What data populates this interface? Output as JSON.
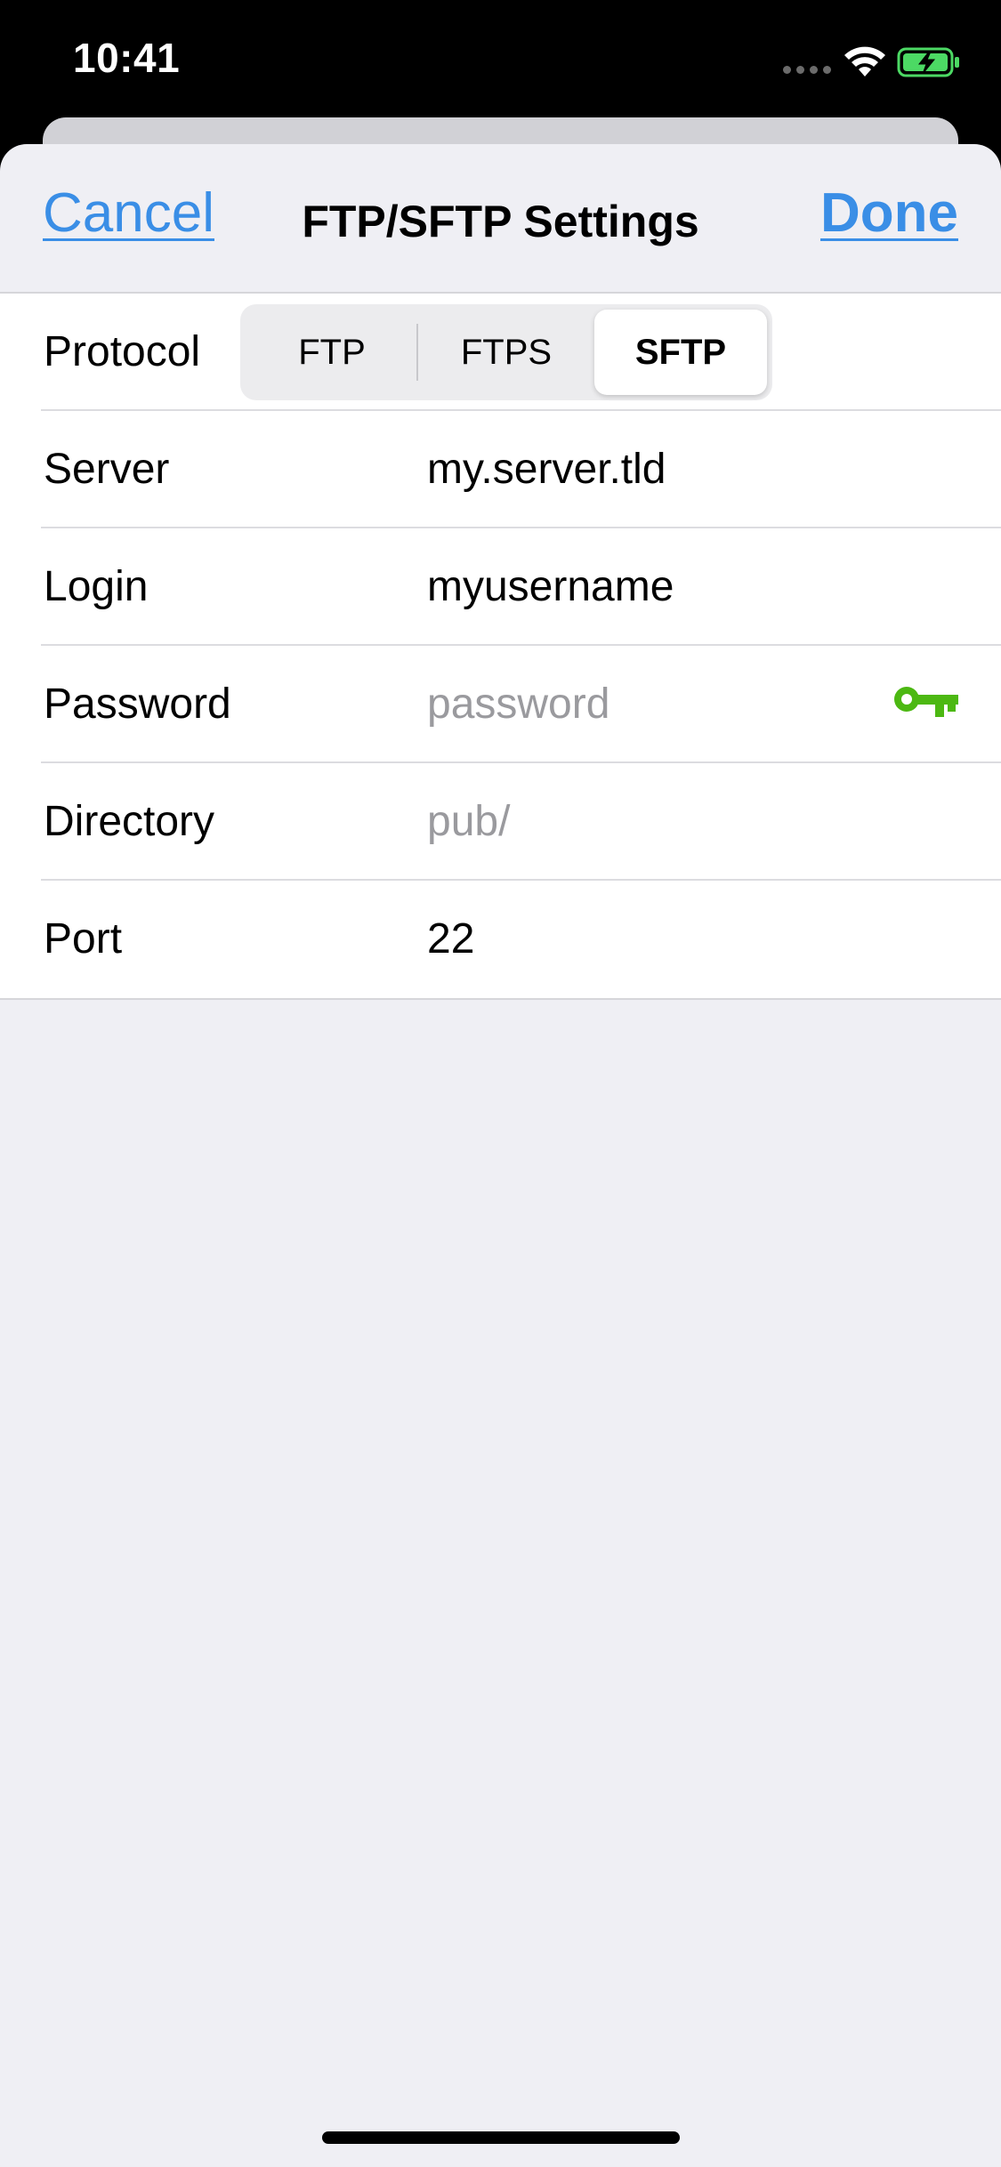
{
  "status_bar": {
    "time": "10:41"
  },
  "nav": {
    "cancel_label": "Cancel",
    "title": "FTP/SFTP Settings",
    "done_label": "Done"
  },
  "form": {
    "protocol": {
      "label": "Protocol",
      "options": [
        "FTP",
        "FTPS",
        "SFTP"
      ],
      "selected": "SFTP"
    },
    "server": {
      "label": "Server",
      "value": "my.server.tld"
    },
    "login": {
      "label": "Login",
      "value": "myusername"
    },
    "password": {
      "label": "Password",
      "value": "",
      "placeholder": "password"
    },
    "directory": {
      "label": "Directory",
      "value": "",
      "placeholder": "pub/"
    },
    "port": {
      "label": "Port",
      "value": "22"
    }
  },
  "colors": {
    "accent": "#3a8ee6",
    "key_icon": "#4cb812",
    "background": "#efeff4"
  },
  "icons": {
    "password_action": "key-icon"
  }
}
